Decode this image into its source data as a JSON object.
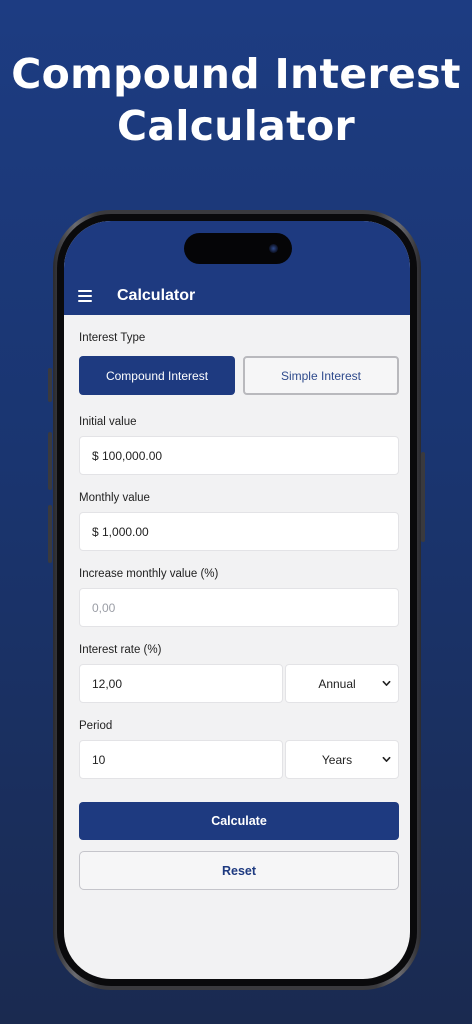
{
  "headline": {
    "line1": "Compound Interest",
    "line2": "Calculator"
  },
  "app": {
    "title": "Calculator"
  },
  "interest_type": {
    "label": "Interest Type",
    "options": [
      "Compound Interest",
      "Simple Interest"
    ],
    "selected": "Compound Interest"
  },
  "initial_value": {
    "label": "Initial value",
    "value": "$ 100,000.00"
  },
  "monthly_value": {
    "label": "Monthly value",
    "value": "$ 1,000.00"
  },
  "increase_monthly": {
    "label": "Increase monthly value (%)",
    "placeholder": "0,00"
  },
  "interest_rate": {
    "label": "Interest rate (%)",
    "value": "12,00",
    "period": "Annual"
  },
  "period": {
    "label": "Period",
    "value": "10",
    "unit": "Years"
  },
  "actions": {
    "calculate": "Calculate",
    "reset": "Reset"
  },
  "colors": {
    "primary": "#1e3a80",
    "background": "#1d3c82",
    "screen": "#f2f2f3"
  }
}
